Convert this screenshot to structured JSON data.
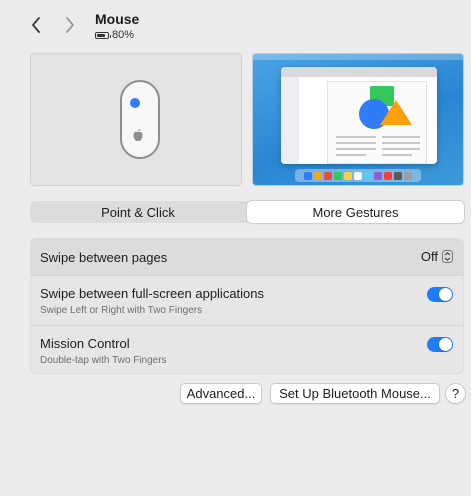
{
  "header": {
    "title": "Mouse",
    "battery_text": "80%",
    "battery_level": 0.8,
    "back_icon": "chevron-left-icon",
    "forward_icon": "chevron-right-icon"
  },
  "tabs": [
    {
      "label": "Point & Click",
      "selected": false
    },
    {
      "label": "More Gestures",
      "selected": true
    }
  ],
  "settings": {
    "swipe_pages": {
      "label": "Swipe between pages",
      "value": "Off"
    },
    "swipe_fullscreen": {
      "label": "Swipe between full-screen applications",
      "sublabel": "Swipe Left or Right with Two Fingers",
      "enabled": true
    },
    "mission_control": {
      "label": "Mission Control",
      "sublabel": "Double-tap with Two Fingers",
      "enabled": true
    }
  },
  "buttons": {
    "advanced": "Advanced...",
    "bluetooth": "Set Up Bluetooth Mouse...",
    "help": "?"
  },
  "colors": {
    "accent": "#1f7cf5",
    "preview_blue": "#2f7cf6",
    "preview_green": "#34c759",
    "preview_orange": "#ff9f0a"
  }
}
